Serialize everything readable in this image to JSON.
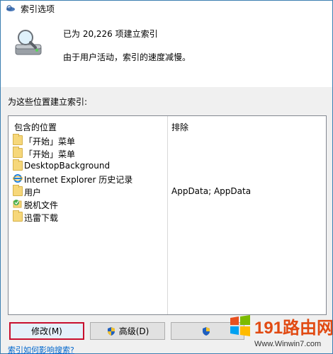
{
  "window": {
    "title": "索引选项"
  },
  "status": {
    "line1": "已为 20,226 项建立索引",
    "line2": "由于用户活动，索引的速度减慢。"
  },
  "section_label": "为这些位置建立索引:",
  "list": {
    "header_included": "包含的位置",
    "header_excluded": "排除",
    "rows": [
      {
        "name": "「开始」菜单",
        "excluded": "",
        "icon": "folder-icon"
      },
      {
        "name": "「开始」菜单",
        "excluded": "",
        "icon": "folder-icon"
      },
      {
        "name": "DesktopBackground",
        "excluded": "",
        "icon": "folder-icon"
      },
      {
        "name": "Internet Explorer 历史记录",
        "excluded": "",
        "icon": "internet-explorer-icon"
      },
      {
        "name": "用户",
        "excluded": "AppData; AppData",
        "icon": "folder-icon"
      },
      {
        "name": "脱机文件",
        "excluded": "",
        "icon": "offline-files-icon"
      },
      {
        "name": "迅雷下载",
        "excluded": "",
        "icon": "folder-icon"
      }
    ]
  },
  "buttons": {
    "modify": "修改(M)",
    "advanced": "高级(D)"
  },
  "help_link": "索引如何影响搜索?",
  "watermark": {
    "text_main": "191路由网",
    "text_url": "Www.Winwin7.com"
  },
  "colors": {
    "accent_border": "#3c7fb1",
    "highlight_red": "#c8102e",
    "link": "#0066cc"
  }
}
